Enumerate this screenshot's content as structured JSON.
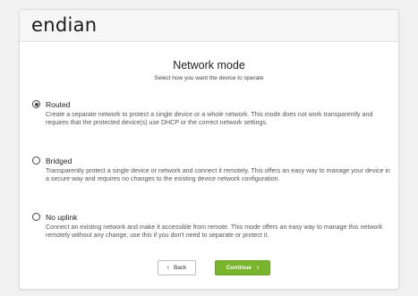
{
  "brand": {
    "logo_text": "endian"
  },
  "page": {
    "title": "Network mode",
    "subtitle": "Select how you want the device to operate"
  },
  "options": [
    {
      "label": "Routed",
      "selected": true,
      "description": "Create a separate network to protect a single device or a whole network. This mode does not work transparently and requires that the protected device(s) use DHCP or the correct network settings."
    },
    {
      "label": "Bridged",
      "selected": false,
      "description": "Transparently protect a single device or network and connect it remotely. This offers an easy way to manage your device in a secure way and requires no changes to the existing device network configuration."
    },
    {
      "label": "No uplink",
      "selected": false,
      "description": "Connect an existing network and make it accessible from remote. This mode offers an easy way to manage this network remotely without any change, use this if you don't need to separate or protect it."
    }
  ],
  "buttons": {
    "back_label": "Back",
    "back_icon": "chevron-left-icon",
    "continue_label": "Continue",
    "continue_icon": "chevron-right-icon",
    "continue_color": "#79b42d"
  }
}
